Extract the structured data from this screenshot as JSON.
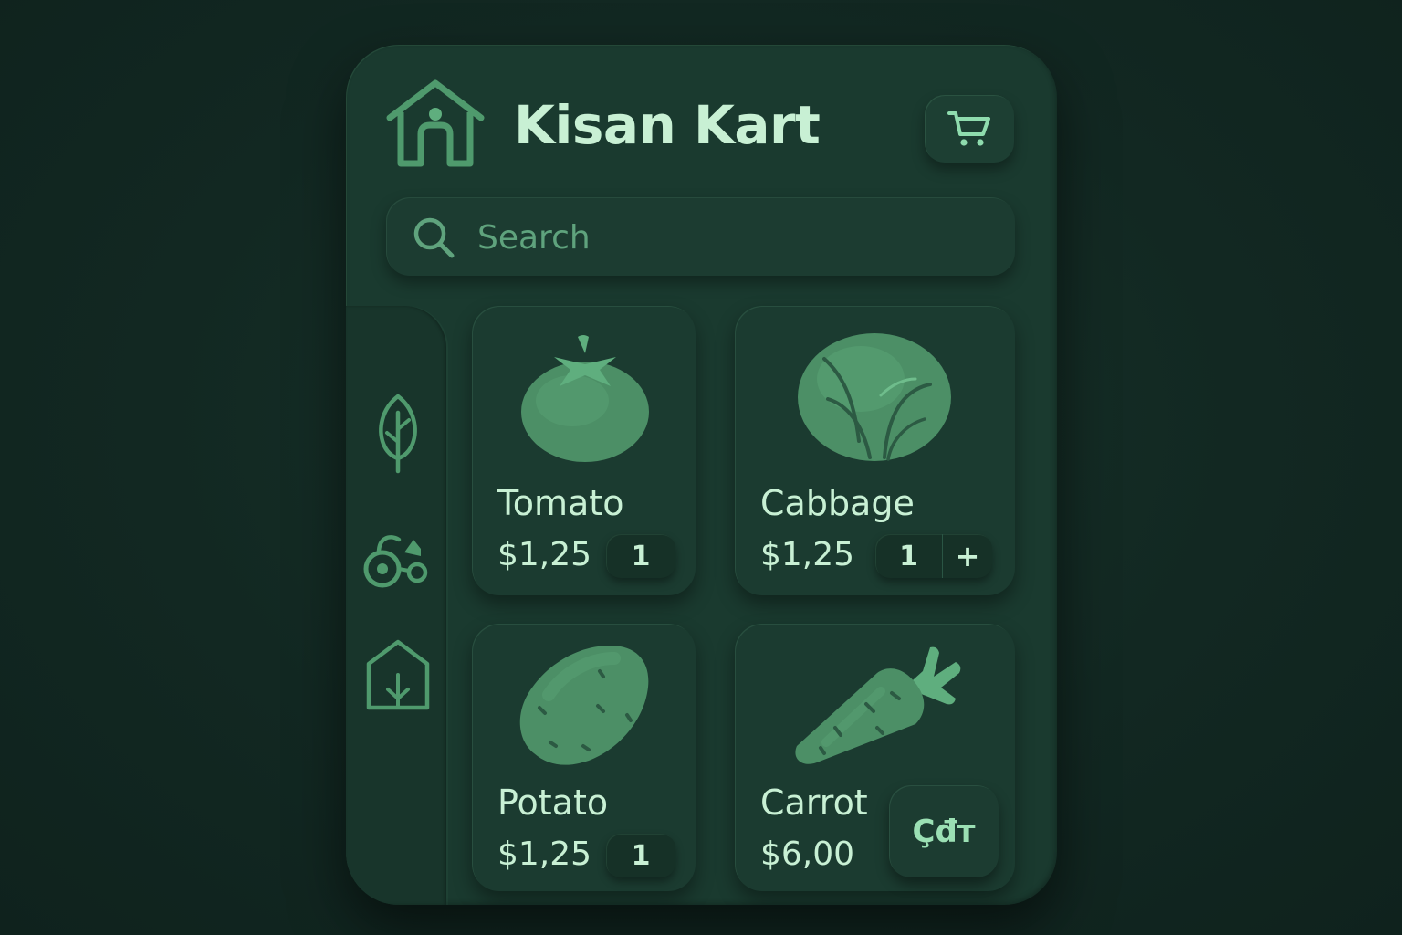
{
  "app": {
    "title": "Kisan Kart",
    "logo_icon": "house-icon",
    "cart_icon": "cart-icon"
  },
  "search": {
    "placeholder": "Search",
    "icon": "search-icon"
  },
  "sidebar": {
    "items": [
      {
        "icon": "leaf-icon"
      },
      {
        "icon": "tractor-icon"
      },
      {
        "icon": "greenhouse-icon"
      }
    ]
  },
  "products": [
    {
      "name": "Tomato",
      "price": "$1,25",
      "qty": "1",
      "icon": "tomato-icon"
    },
    {
      "name": "Cabbage",
      "price": "$1,25",
      "qty": "1",
      "plus": "+",
      "icon": "cabbage-icon"
    },
    {
      "name": "Potato",
      "price": "$1,25",
      "qty": "1",
      "icon": "potato-icon"
    },
    {
      "name": "Carrot",
      "price": "$6,00",
      "action_label": "Çđт",
      "icon": "carrot-icon"
    }
  ],
  "colors": {
    "background": "#122822",
    "panel": "#1a3a2f",
    "accent": "#4f9a6d",
    "text": "#c8f0d4",
    "muted": "#5fa37d"
  }
}
